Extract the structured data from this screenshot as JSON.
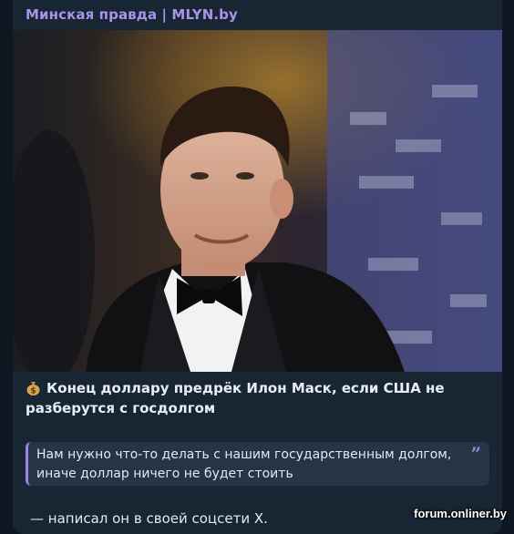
{
  "channel": {
    "name": "Минская правда | MLYN.by"
  },
  "post": {
    "image_alt": "Elon Musk in a tuxedo with bow tie",
    "headline_icon": "money-bag-icon",
    "headline": "Конец доллару предрёк Илон Маск, если США не разберутся с госдолгом",
    "quote": "Нам нужно что-то делать с нашим государственным долгом, иначе доллар ничего не будет стоить",
    "quote_icon": "quote-marks-icon",
    "footer": "— написал он в своей соцсети X."
  },
  "watermark": "forum.onliner.by",
  "colors": {
    "background": "#0e1621",
    "bubble": "#182533",
    "accent": "#a695e7",
    "quote_bg": "#263445",
    "text": "#e9eef4"
  }
}
